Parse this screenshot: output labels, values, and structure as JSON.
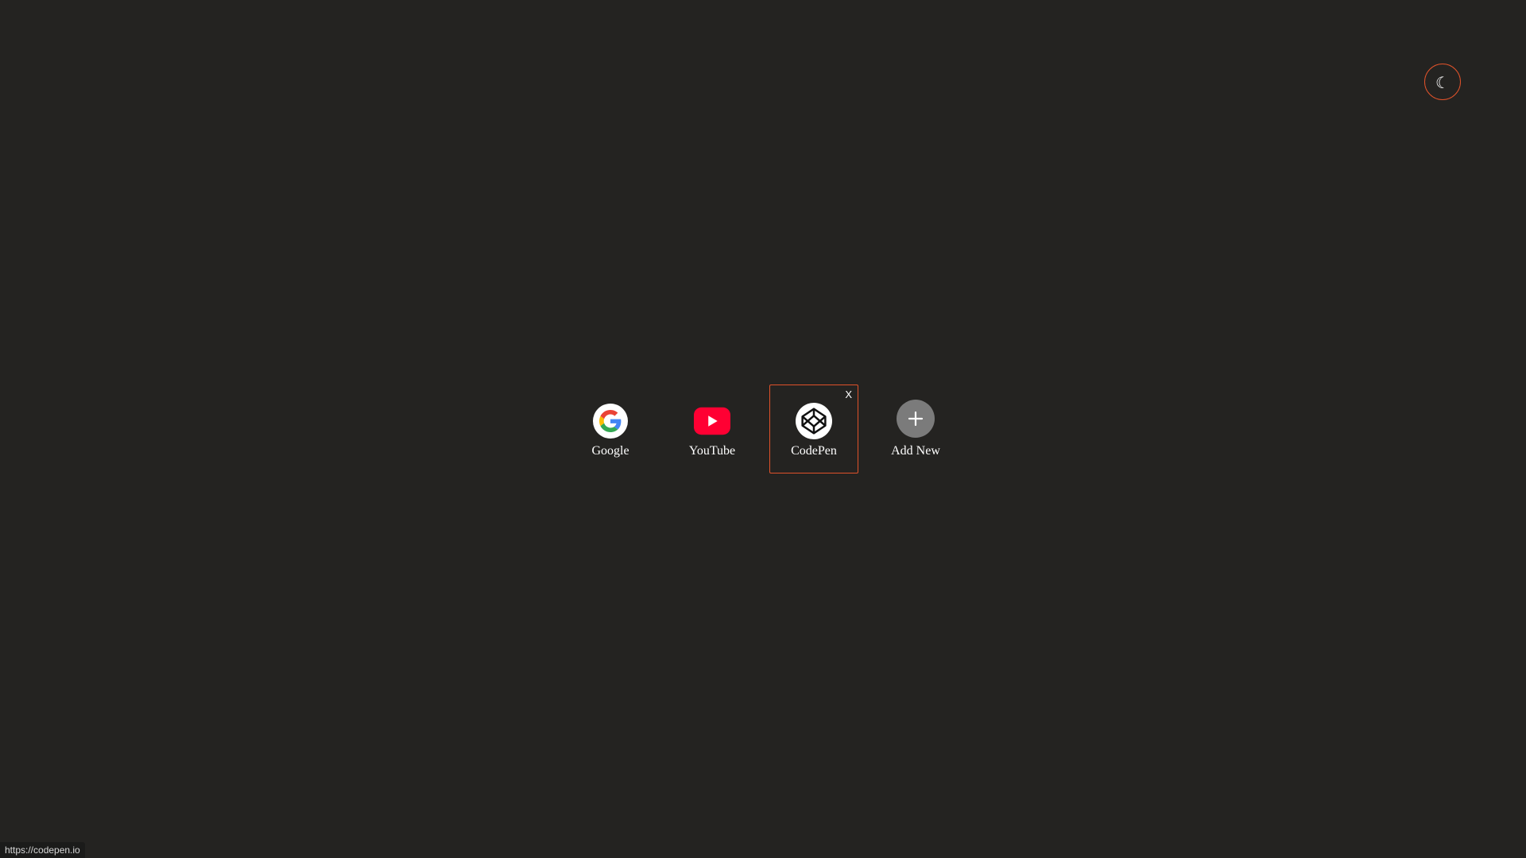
{
  "theme_toggle": {
    "icon": "moon-icon",
    "glyph": "☾",
    "accent_color": "#e0522a"
  },
  "shortcuts": [
    {
      "label": "Google",
      "icon": "google-icon",
      "selected": false
    },
    {
      "label": "YouTube",
      "icon": "youtube-icon",
      "selected": false
    },
    {
      "label": "CodePen",
      "icon": "codepen-icon",
      "selected": true,
      "close_label": "X"
    }
  ],
  "add_new": {
    "label": "Add New",
    "icon": "plus-icon",
    "icon_color": "#7b7b7b"
  },
  "status_bar": {
    "url": "https://codepen.io"
  },
  "colors": {
    "background": "#242321",
    "accent": "#e0522a",
    "youtube_red": "#ff0033"
  }
}
